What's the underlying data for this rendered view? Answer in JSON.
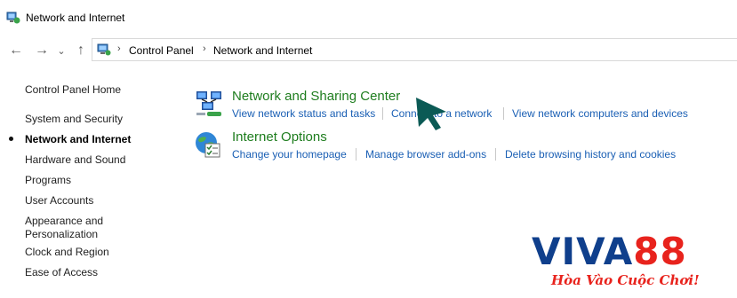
{
  "window": {
    "title": "Network and Internet"
  },
  "nav": {
    "back_glyph": "←",
    "forward_glyph": "→",
    "recent_glyph": "⌄",
    "up_glyph": "↑",
    "breadcrumb": [
      "Control Panel",
      "Network and Internet"
    ],
    "separator": "›"
  },
  "sidebar": {
    "items": [
      {
        "label": "Control Panel Home"
      },
      {
        "label": "System and Security"
      },
      {
        "label": "Network and Internet",
        "active": true
      },
      {
        "label": "Hardware and Sound"
      },
      {
        "label": "Programs"
      },
      {
        "label": "User Accounts"
      },
      {
        "label": "Appearance and Personalization"
      },
      {
        "label": "Clock and Region"
      },
      {
        "label": "Ease of Access"
      }
    ],
    "appearance_line1": "Appearance and",
    "appearance_line2": "Personalization"
  },
  "categories": [
    {
      "title": "Network and Sharing Center",
      "icon": "network-sharing-icon",
      "tasks": [
        "View network status and tasks",
        "Connect to a network",
        "View network computers and devices"
      ]
    },
    {
      "title": "Internet Options",
      "icon": "internet-options-icon",
      "tasks": [
        "Change your homepage",
        "Manage browser add-ons",
        "Delete browsing history and cookies"
      ]
    }
  ],
  "logo": {
    "part1": "VIVA",
    "part2": "88",
    "slogan": "Hòa Vào Cuộc Chơi!"
  },
  "colors": {
    "link": "#1a5fb4",
    "category_title": "#1e7d1e",
    "cursor": "#0b5a55",
    "logo_blue": "#0f3f8c",
    "logo_red": "#e8231d"
  }
}
